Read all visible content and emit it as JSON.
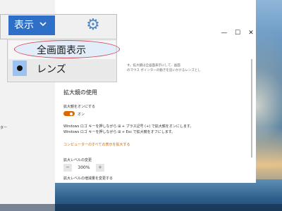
{
  "magnifier": {
    "view_button": {
      "label": "表示",
      "chevron": "chevron-down-icon"
    },
    "settings_icon": "gear-icon",
    "menu": {
      "items": [
        {
          "label": "全画面表示",
          "highlighted": true
        },
        {
          "label": "レンズ",
          "selected": true
        }
      ]
    }
  },
  "window": {
    "controls": {
      "minimize": "—",
      "maximize": "☐",
      "close": "✕"
    }
  },
  "settings": {
    "intro_line1": "す。拡大鏡は全画面表示にして、画面",
    "intro_line2": "のマウス ポインターの動きを追いかけるレンズとし",
    "section_title": "拡大鏡の使用",
    "toggle_label": "拡大鏡をオンにする",
    "toggle_state": "オン",
    "hint_line1": "Windows ロゴ キーを押しながら ⊞ + プラス記号 (+) で拡大鏡をオンにします。",
    "hint_line2": "Windows ロゴ キーを押しながら ⊞ + Esc で拡大鏡をオフにします。",
    "link": "コンピューターのすべての表示を拡大する",
    "zoom_label": "拡大レベルの変更",
    "zoom_minus": "－",
    "zoom_value": "300%",
    "zoom_plus": "＋",
    "increment_label": "拡大レベルの増減量を変更する"
  },
  "left_pane": {
    "partial_label": "ター"
  },
  "colors": {
    "accent": "#2e6fc7",
    "toggle": "#d86a00",
    "link": "#c66a00",
    "highlight_ring": "#d04a5a"
  }
}
